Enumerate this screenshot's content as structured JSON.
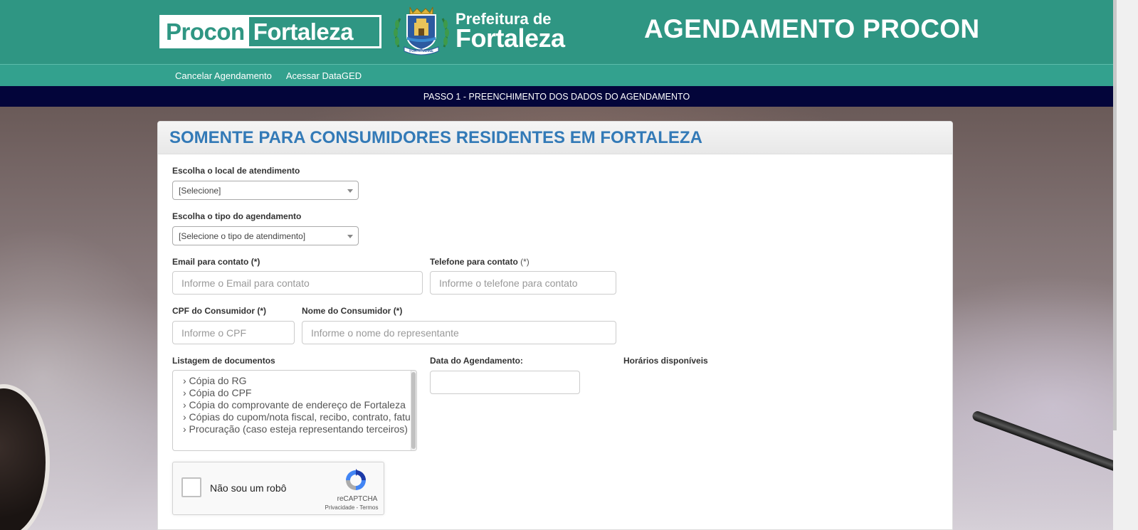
{
  "header": {
    "logo_procon_1": "Procon",
    "logo_procon_2": "Fortaleza",
    "crest_motto": "FORTITUDINE",
    "prefeitura_line1": "Prefeitura de",
    "prefeitura_line2": "Fortaleza",
    "app_title": "AGENDAMENTO PROCON"
  },
  "nav": {
    "items": [
      {
        "label": "Cancelar Agendamento"
      },
      {
        "label": "Acessar DataGED"
      }
    ]
  },
  "step": {
    "label": "PASSO 1 - PREENCHIMENTO DOS DADOS DO AGENDAMENTO"
  },
  "form": {
    "title": "SOMENTE PARA CONSUMIDORES RESIDENTES EM FORTALEZA",
    "local": {
      "label": "Escolha o local de atendimento",
      "value": "[Selecione]"
    },
    "tipo": {
      "label": "Escolha o tipo do agendamento",
      "value": "[Selecione o tipo de atendimento]"
    },
    "email": {
      "label": "Email para contato",
      "required": "(*)",
      "placeholder": "Informe o Email para contato"
    },
    "telefone": {
      "label": "Telefone para contato",
      "required": "(*)",
      "placeholder": "Informe o telefone para contato"
    },
    "cpf": {
      "label": "CPF do Consumidor",
      "required": "(*)",
      "placeholder": "Informe o CPF"
    },
    "nome": {
      "label": "Nome do Consumidor",
      "required": "(*)",
      "placeholder": "Informe o nome do representante"
    },
    "documentos": {
      "label": "Listagem de documentos",
      "items": [
        "› Cópia do RG",
        "› Cópia do CPF",
        "› Cópia do comprovante de endereço de Fortaleza",
        "› Cópias do cupom/nota fiscal, recibo, contrato, fatura",
        "› Procuração (caso esteja representando terceiros)"
      ]
    },
    "data": {
      "label": "Data do Agendamento:",
      "value": ""
    },
    "horarios": {
      "label": "Horários disponíveis"
    },
    "captcha": {
      "label": "Não sou um robô",
      "brand": "reCAPTCHA",
      "privacy": "Privacidade",
      "separator": " - ",
      "terms": "Termos"
    }
  },
  "colors": {
    "header_bg": "#2f9683",
    "nav_bg": "#33a18e",
    "stepbar_bg": "#03053a",
    "title_blue": "#337ab7"
  }
}
